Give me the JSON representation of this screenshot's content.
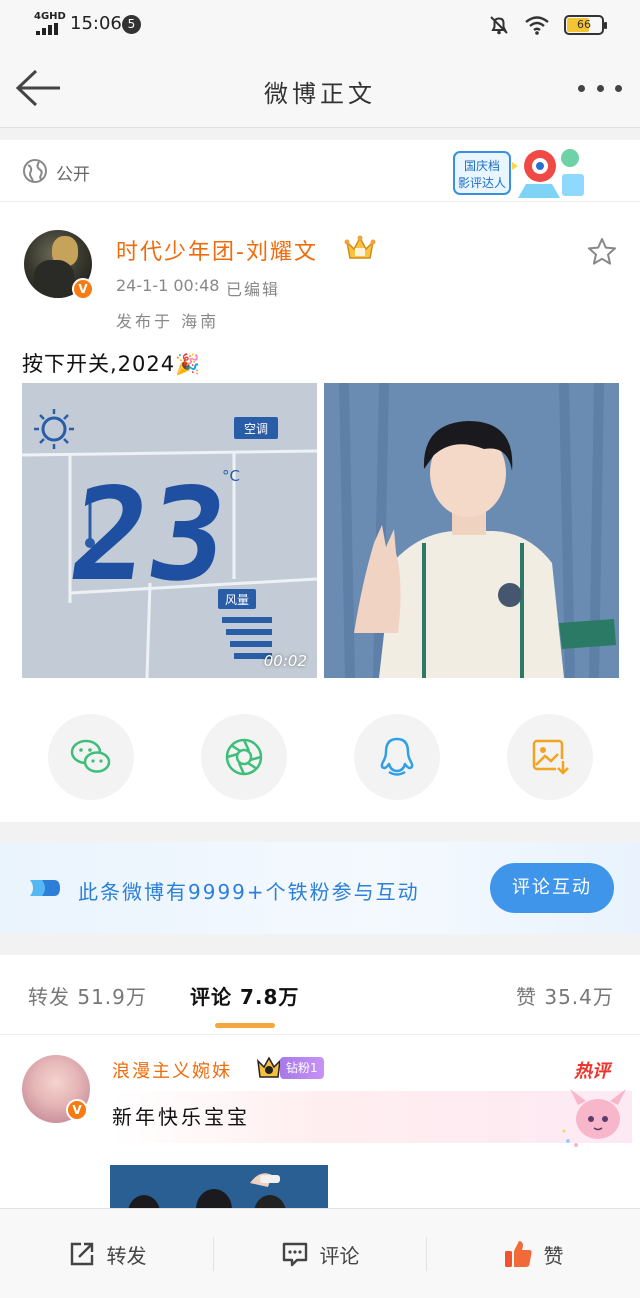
{
  "status_bar": {
    "network": "4GHD",
    "time": "15:06",
    "notification_count": "5",
    "battery": "66"
  },
  "nav": {
    "title": "微博正文"
  },
  "visibility": {
    "label": "公开",
    "festival_line1": "国庆档",
    "festival_line2": "影评达人"
  },
  "post": {
    "author": "时代少年团-刘耀文",
    "time": "24-1-1 00:48",
    "edited": "已编辑",
    "location": "发布于 海南",
    "text": "按下开关,2024",
    "emoji": "🎉",
    "video_duration": "00:02",
    "panel_label_ac": "空调",
    "panel_temp": "23",
    "panel_unit": "°C",
    "panel_label_fan": "风量",
    "verified_mark": "V"
  },
  "share": {
    "items": [
      "wechat-icon",
      "moments-icon",
      "qq-icon",
      "save-image-icon"
    ]
  },
  "banner": {
    "text": "此条微博有9999+个铁粉参与互动",
    "button": "评论互动"
  },
  "tabs": {
    "repost": "转发 51.9万",
    "comments": "评论 7.8万",
    "likes": "赞 35.4万"
  },
  "comment": {
    "name": "浪漫主义婉妹",
    "fan_badge": "钻粉1",
    "hot_label": "热评",
    "text": "新年快乐宝宝"
  },
  "bottom_bar": {
    "repost": "转发",
    "comment": "评论",
    "like": "赞"
  },
  "colors": {
    "brand_orange": "#f06b0b",
    "link_blue": "#2c7fd9",
    "button_blue": "#3f95ea",
    "tab_underline": "#f4a73a"
  }
}
